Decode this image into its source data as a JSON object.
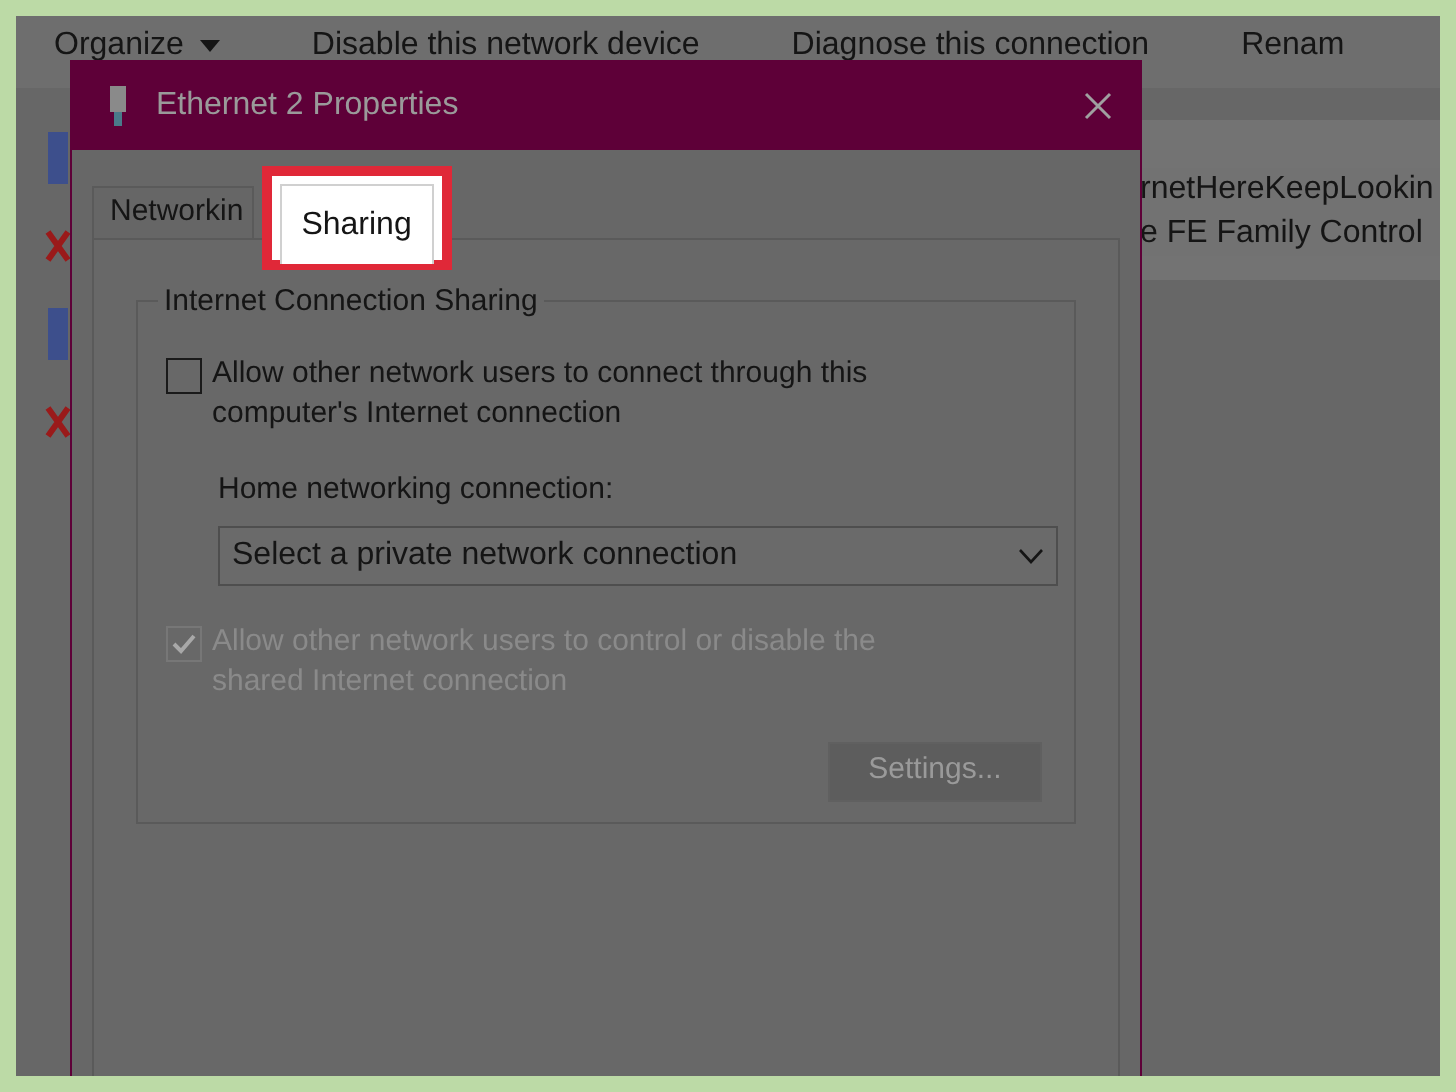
{
  "toolbar": {
    "items": [
      {
        "label": "Organize",
        "kind": "menu"
      },
      {
        "label": "Disable this network device",
        "kind": "command"
      },
      {
        "label": "Diagnose this connection",
        "kind": "command"
      },
      {
        "label": "Renam",
        "kind": "command"
      }
    ]
  },
  "connections": [
    {
      "line_1": "rnetHereKeepLookin",
      "line_2": "e FE Family Control",
      "selected": true
    }
  ],
  "dialog": {
    "title": "Ethernet 2 Properties",
    "tabs": [
      {
        "label": "Networkin",
        "selected": false
      },
      {
        "label": "Sharing",
        "selected": true
      }
    ],
    "group": {
      "legend": "Internet Connection Sharing",
      "allow_connect": {
        "label": "Allow other network users to connect through this computer's Internet connection",
        "checked": false,
        "disabled": false
      },
      "home_label": "Home networking connection:",
      "home_dropdown": {
        "value": "Select a private network connection"
      },
      "allow_control": {
        "label": "Allow other network users to control or disable the shared Internet connection",
        "checked": true,
        "disabled": true
      },
      "settings_button": {
        "label": "Settings...",
        "disabled": true
      }
    }
  }
}
